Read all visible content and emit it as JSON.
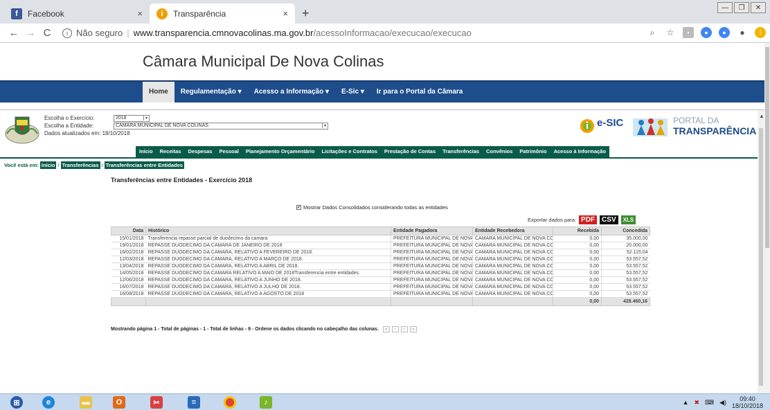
{
  "browser": {
    "tabs": [
      {
        "title": "Facebook",
        "close": "×"
      },
      {
        "title": "Transparência",
        "close": "×"
      }
    ],
    "new_tab": "+",
    "address": {
      "security": "Não seguro",
      "host": "www.transparencia.cmnovacolinas.ma.gov.br",
      "path": "/acessoInformacao/execucao/execucao"
    }
  },
  "site": {
    "title": "Câmara Municipal De Nova Colinas",
    "topnav": [
      "Home",
      "Regulamentação ▾",
      "Acesso a Informação ▾",
      "E-Sic ▾",
      "Ir para o Portal da Câmara"
    ]
  },
  "portal": {
    "fields": {
      "exercicio_label": "Escolha o Exercício:",
      "exercicio_value": "2018",
      "entidade_label": "Escolha a Entidade:",
      "entidade_value": "CAMARA MUNICIPAL DE NOVA COLINAS",
      "updated": "Dados atualizados em: 18/10/2018"
    },
    "esic_label": "e-SIC",
    "portal_line1": "PORTAL DA",
    "portal_line2": "TRANSPARÊNCIA",
    "subnav": [
      "Início",
      "Receitas",
      "Despesas",
      "Pessoal",
      "Planejamento Orçamentário",
      "Licitações e Contratos",
      "Prestação de Contas",
      "Transferências",
      "Convênios",
      "Patrimônio",
      "Acesso à Informação"
    ],
    "breadcrumb": {
      "prefix": "Você está em:",
      "items": [
        "Início",
        "Transferências",
        "Transferências entre Entidades"
      ],
      "sep": "/"
    },
    "page_title": "Transferências entre Entidades - Exercício 2018",
    "consolidated_label": "Mostrar Dados Consolidados considerando todas as entidades",
    "export": {
      "label": "Exportar dados para:",
      "pdf": "PDF",
      "csv": "CSV",
      "xls": "XLS"
    },
    "table": {
      "headers": [
        "Data",
        "Histórico",
        "Entidade Pagadora",
        "Entidade Recebedora",
        "Recebida",
        "Concedida"
      ],
      "rows": [
        [
          "15/01/2018",
          "Transferencia repasse parcial de duodecimo da camara",
          "PREFEITURA MUNICIPAL DE NOVA",
          "CAMARA MUNICIPAL DE NOVA CC",
          "0,00",
          "35.000,00"
        ],
        [
          "19/01/2018",
          "REPASSE DUODECIMO DA CAMARA DE JANEIRO DE 2018",
          "PREFEITURA MUNICIPAL DE NOVA",
          "CAMARA MUNICIPAL DE NOVA CC",
          "0,00",
          "20.000,00"
        ],
        [
          "16/02/2018",
          "REPASSE DUODECIMO DA CAMARA, RELATIVO A FEVEREIRO DE 2018.",
          "PREFEITURA MUNICIPAL DE NOVA",
          "CAMARA MUNICIPAL DE NOVA CC",
          "0,00",
          "52.115,04"
        ],
        [
          "12/03/2018",
          "REPASSE DUODECIMO DA CAMARA, RELATIVO A MARÇO DE 2018.",
          "PREFEITURA MUNICIPAL DE NOVA",
          "CAMARA MUNICIPAL DE NOVA CC",
          "0,00",
          "53.557,52"
        ],
        [
          "13/04/2018",
          "REPASSE DUODECIMO DA CAMARA, RELATIVO A ABRIL DE 2018.",
          "PREFEITURA MUNICIPAL DE NOVA",
          "CAMARA MUNICIPAL DE NOVA CC",
          "0,00",
          "53.557,52"
        ],
        [
          "14/05/2018",
          "REPASSE DUODECIMO DA CAMARA RELATIVO A MAIO DE 2018Transferencia entre entidades.",
          "PREFEITURA MUNICIPAL DE NOVA",
          "CAMARA MUNICIPAL DE NOVA CC",
          "0,00",
          "53.557,52"
        ],
        [
          "12/06/2018",
          "REPASSE DUODECIMO DA CAMARA, RELATIVO A JUNHO DE 2018.",
          "PREFEITURA MUNICIPAL DE NOVA",
          "CAMARA MUNICIPAL DE NOVA CC",
          "0,00",
          "53.557,52"
        ],
        [
          "16/07/2018",
          "REPASSE DUODECIMO DA CAMARA, RELATIVO A JULHO DE 2018.",
          "PREFEITURA MUNICIPAL DE NOVA",
          "CAMARA MUNICIPAL DE NOVA CC",
          "0,00",
          "53.557,52"
        ],
        [
          "16/08/2018",
          "REPASSE DUODECIMO DA CAMARA, RELATIVO A AGOSTO DE 2018",
          "PREFEITURA MUNICIPAL DE NOVA",
          "CAMARA MUNICIPAL DE NOVA CC",
          "0,00",
          "53.557,52"
        ]
      ],
      "total_recebida": "0,00",
      "total_concedida": "428.460,16"
    },
    "footer_info": "Mostrando página 1 - Total de páginas - 1 - Total de linhas - 9 - Ordene os dados clicando no cabeçalho das colunas."
  },
  "taskbar": {
    "apps": [
      "start-orb",
      "internet-explorer",
      "file-explorer",
      "outlook",
      "snipping-tool",
      "document-viewer",
      "chrome",
      "pdf-reader"
    ],
    "time": "09:40",
    "date": "18/10/2018"
  },
  "colors": {
    "topnav": "#1e4d8c",
    "subnav": "#0a5c4a",
    "pdf": "#d31f1f",
    "xls": "#3e8e2e"
  }
}
